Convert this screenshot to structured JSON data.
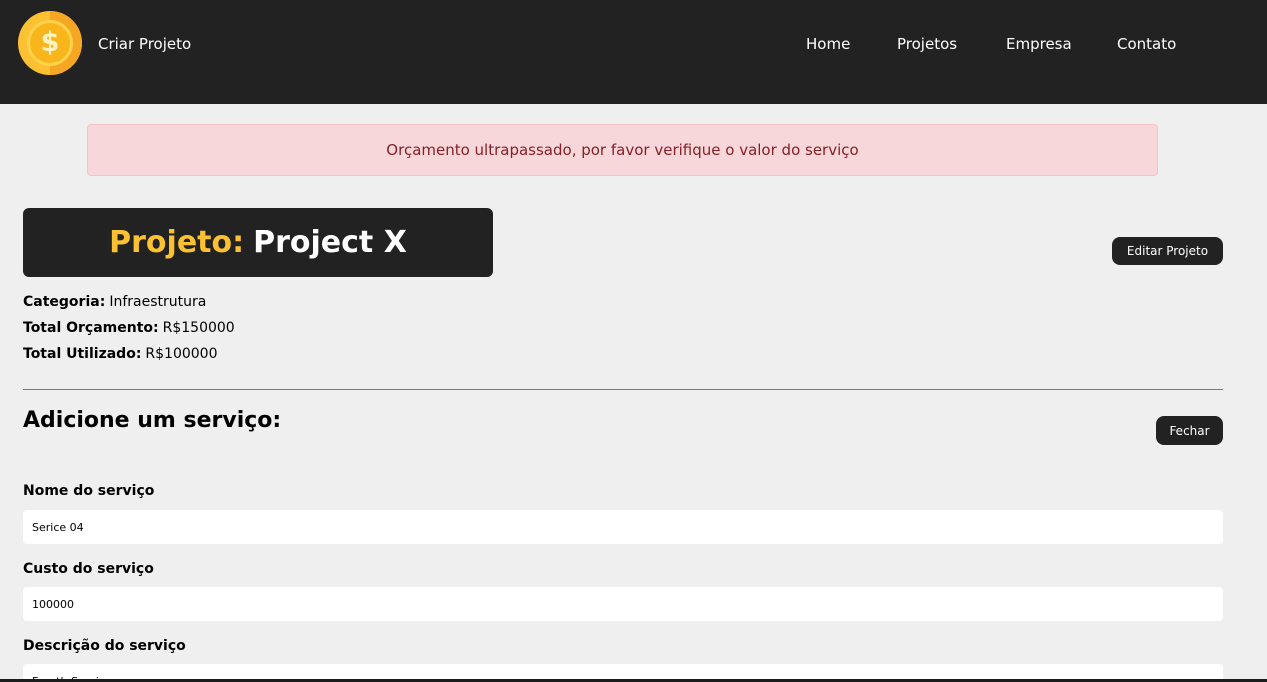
{
  "navbar": {
    "brand_label": "Criar Projeto",
    "logo_icon": "dollar-coin-icon",
    "logo_symbol": "$",
    "links": [
      "Home",
      "Projetos",
      "Empresa",
      "Contato"
    ]
  },
  "alert": {
    "message": "Orçamento ultrapassado, por favor verifique o valor do serviço",
    "type": "error"
  },
  "project": {
    "title_prefix": "Projeto:",
    "name": "Project X",
    "edit_label": "Editar Projeto",
    "category_label": "Categoria:",
    "category_value": "Infraestrutura",
    "budget_label": "Total Orçamento:",
    "budget_value": "R$150000",
    "used_label": "Total Utilizado:",
    "used_value": "R$100000"
  },
  "service_form": {
    "title": "Adicione um serviço:",
    "close_label": "Fechar",
    "name_label": "Nome do serviço",
    "name_value": "Serice 04",
    "cost_label": "Custo do serviço",
    "cost_value": "100000",
    "description_label": "Descrição do serviço",
    "description_value": "Fourth Service"
  },
  "colors": {
    "navbar_bg": "#222222",
    "accent": "#fcc132",
    "page_bg": "#efefef",
    "alert_bg": "#f8d7da",
    "alert_text": "#842029"
  }
}
